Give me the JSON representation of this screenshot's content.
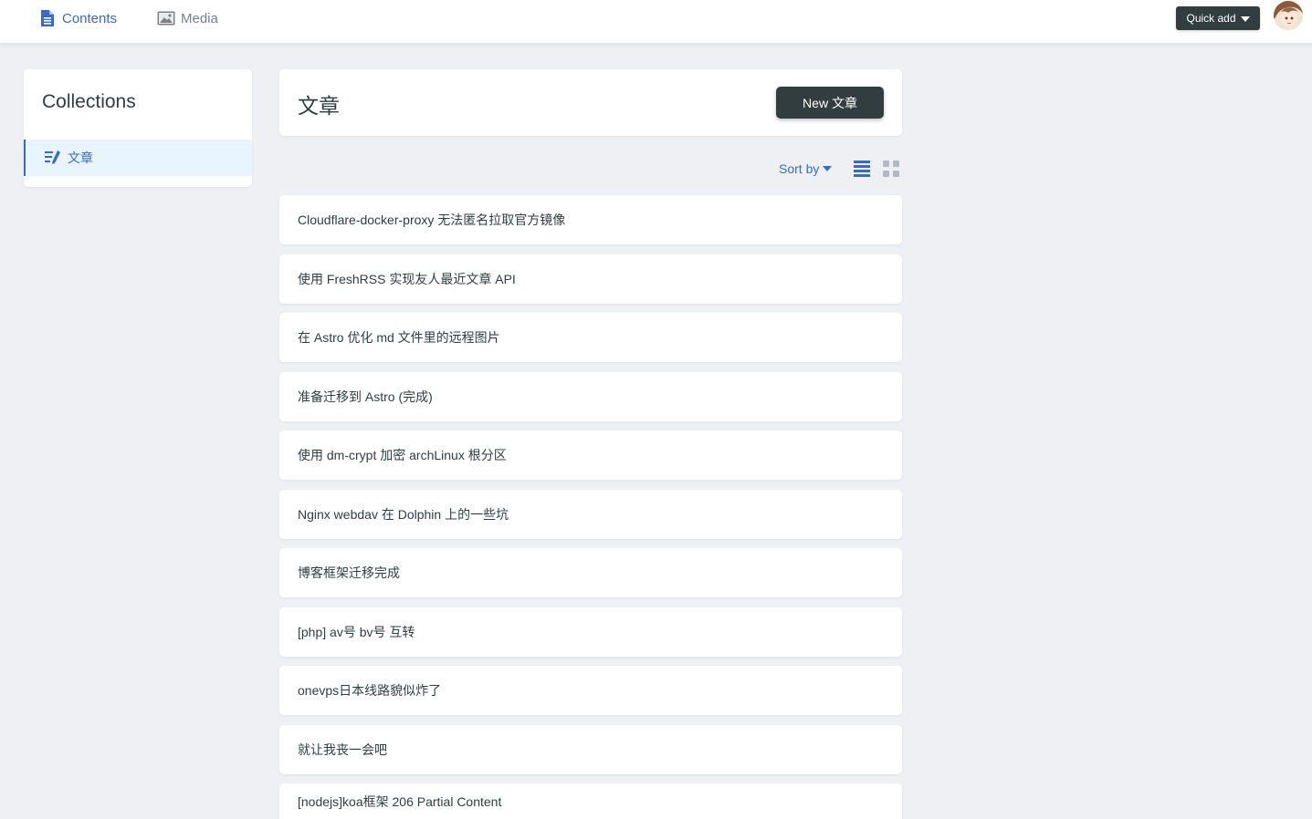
{
  "topbar": {
    "nav": [
      {
        "label": "Contents",
        "icon": "document-icon",
        "active": true
      },
      {
        "label": "Media",
        "icon": "image-icon",
        "active": false
      }
    ],
    "quick_add_label": "Quick add",
    "avatar": "user-avatar"
  },
  "sidebar": {
    "title": "Collections",
    "items": [
      {
        "label": "文章",
        "icon": "edit-lines-icon",
        "active": true
      }
    ]
  },
  "collection": {
    "title": "文章",
    "new_button_label": "New 文章"
  },
  "controls": {
    "sort_label": "Sort by",
    "view_modes": [
      "list-view-icon",
      "grid-view-icon"
    ],
    "active_view": "list"
  },
  "entries": [
    {
      "title": "Cloudflare-docker-proxy 无法匿名拉取官方镜像"
    },
    {
      "title": "使用 FreshRSS 实现友人最近文章 API"
    },
    {
      "title": "在 Astro 优化 md 文件里的远程图片"
    },
    {
      "title": "准备迁移到 Astro (完成)"
    },
    {
      "title": "使用 dm-crypt 加密 archLinux 根分区"
    },
    {
      "title": "Nginx webdav 在 Dolphin 上的一些坑"
    },
    {
      "title": "博客框架迁移完成"
    },
    {
      "title": "[php] av号 bv号 互转"
    },
    {
      "title": "onevps日本线路貌似炸了"
    },
    {
      "title": "就让我丧一会吧"
    },
    {
      "title": "[nodejs]koa框架 206 Partial Content"
    }
  ],
  "colors": {
    "accent": "#3a69c7",
    "dark": "#313d3e",
    "background": "#eff0f4",
    "active_item_bg": "#e8f5fe"
  }
}
